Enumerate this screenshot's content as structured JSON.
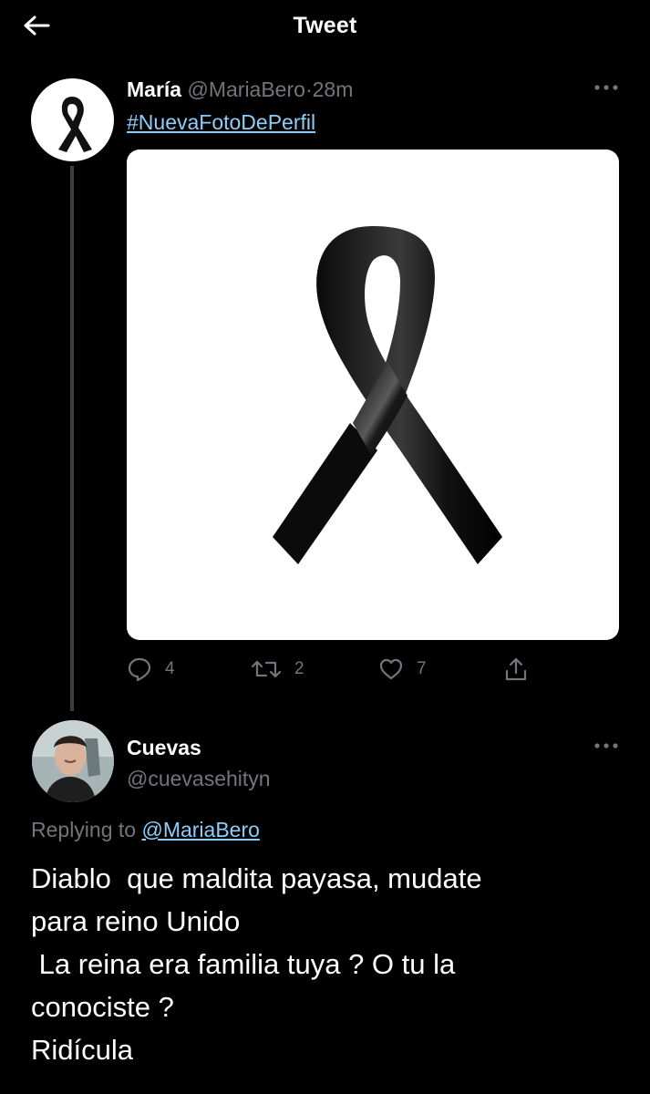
{
  "header": {
    "title": "Tweet",
    "back_icon": "arrow-left-icon"
  },
  "tweet": {
    "author_name": "María",
    "author_handle": "@MariaBero",
    "separator": "·",
    "time": "28m",
    "hashtag": "#NuevaFotoDePerfil",
    "avatar": "black-ribbon",
    "media": "black-mourning-ribbon",
    "actions": {
      "reply_count": "4",
      "retweet_count": "2",
      "like_count": "7"
    }
  },
  "reply": {
    "author_name": "Cuevas",
    "author_handle": "@cuevasehityn",
    "replying_to_label": "Replying to",
    "replying_to_handle": "@MariaBero",
    "text": "Diablo  que maldita payasa, mudate\npara reino Unido\n La reina era familia tuya ? O tu la\nconociste ?\nRidícula"
  },
  "colors": {
    "background": "#000000",
    "link": "#8ecdf8",
    "muted": "#71767b",
    "thread_line": "#3d4043"
  }
}
